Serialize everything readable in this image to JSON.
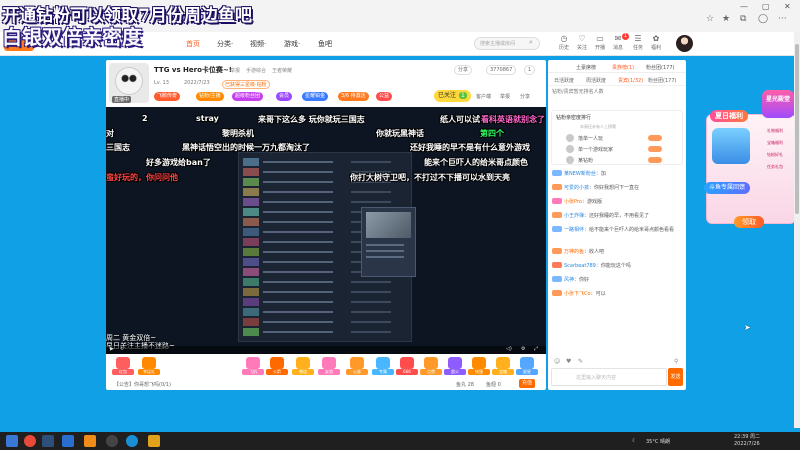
{
  "overlay": {
    "line1": "开通钻粉可以领取7月份周边鱼吧",
    "line2": "白银双倍亲密度"
  },
  "nav": {
    "items": [
      "首页",
      "分类·",
      "视频·",
      "游戏·",
      "鱼吧"
    ],
    "search_placeholder": "搜索主播或房间",
    "tools": [
      {
        "icon": "history-icon",
        "glyph": "◷",
        "label": "历史"
      },
      {
        "icon": "follow-icon",
        "glyph": "♡",
        "label": "关注"
      },
      {
        "icon": "anchor-icon",
        "glyph": "▭",
        "label": "开播"
      },
      {
        "icon": "mail-icon",
        "glyph": "✉",
        "label": "消息"
      },
      {
        "icon": "message-icon",
        "glyph": "☰",
        "label": "任务"
      },
      {
        "icon": "gift-icon",
        "glyph": "✿",
        "label": "福利"
      }
    ],
    "badge_count": "1"
  },
  "player": {
    "title": "TTG vs Hero卡位赛~!",
    "tags": [
      "举报",
      "手游综合",
      "王者荣耀"
    ],
    "meta": [
      "Lv. 13",
      "2022/7/23",
      "已获得三星级·钻粉"
    ],
    "live_badge": "直播中",
    "pills": [
      {
        "text": "飞鹅传奇",
        "color": "#ff5b2e"
      },
      {
        "text": "钻粉/主播",
        "color": "#ff8a00"
      },
      {
        "text": "超级粉丝团",
        "color": "#c53ef0"
      },
      {
        "text": "会员",
        "color": "#9a48ff"
      },
      {
        "text": "星耀铂金",
        "color": "#3a7bff"
      },
      {
        "text": "3/6 待激活",
        "color": "#ff7a1c"
      },
      {
        "text": "公益",
        "color": "#ff4d4d"
      }
    ],
    "hdr_buttons": [
      "分享",
      "3770867",
      "1"
    ],
    "follow_label": "已关注",
    "follow_count": "1",
    "hdr_right": [
      "客户端",
      "举报",
      "分享"
    ]
  },
  "danmaku": [
    {
      "text": "2",
      "color": "#ffffff"
    },
    {
      "text": "stray",
      "color": "#ffffff"
    },
    {
      "text": "来哥下这么多 玩你就玩三国志",
      "color": "#ffffff"
    },
    {
      "text": "纸人可以试",
      "color": "#ffffff"
    },
    {
      "text": "看科英语就别念了",
      "color": "#ff66cc"
    },
    {
      "text": "对",
      "color": "#ffffff"
    },
    {
      "text": "黎明杀机",
      "color": "#ffffff"
    },
    {
      "text": "你就玩黑神话",
      "color": "#ffffff"
    },
    {
      "text": "第四个",
      "color": "#33ff66"
    },
    {
      "text": "三国志",
      "color": "#ffffff"
    },
    {
      "text": "黑神话悟空出的时候一万九都淘汰了",
      "color": "#ffffff"
    },
    {
      "text": "还好我睡的早不是有什么意外游戏",
      "color": "#ffffff"
    },
    {
      "text": "好多游戏给ban了",
      "color": "#ffffff"
    },
    {
      "text": "能来个巨吓人的给米哥点颜色",
      "color": "#ffffff"
    },
    {
      "text": "蛮好玩的，你问问他",
      "color": "#ff4444"
    },
    {
      "text": "你打大树守卫吧，不打过不下播可以水到天亮",
      "color": "#ffffff"
    }
  ],
  "video_notes": [
    "周二 黄金双倍~",
    "早日关注主播不迷路~"
  ],
  "gifts": [
    {
      "label": "红包",
      "color": "#ff5e5e"
    },
    {
      "label": "幸运礼",
      "color": "#ff8a00"
    },
    {
      "label": "飞机",
      "color": "#ff7ab8"
    },
    {
      "label": "火箭",
      "color": "#ff6a00"
    },
    {
      "label": "赠送",
      "color": "#ffb01c"
    },
    {
      "label": "友谊",
      "color": "#ff7ab8"
    },
    {
      "label": "心意",
      "color": "#ff9a2a"
    },
    {
      "label": "专属",
      "color": "#48b7ff"
    },
    {
      "label": "666",
      "color": "#ff4d4d"
    },
    {
      "label": "点赞",
      "color": "#ff9a2a"
    },
    {
      "label": "超火",
      "color": "#8e5cff"
    },
    {
      "label": "帐篷",
      "color": "#ff8a00"
    },
    {
      "label": "宝箱",
      "color": "#ffb01c"
    },
    {
      "label": "星星",
      "color": "#55a6ff"
    },
    {
      "label": "礼盒",
      "color": "#ff6a9a"
    }
  ],
  "bottom_bar": {
    "announcement": "【公告】你哥想飞吗(0/1)",
    "fish_balls": "鱼丸 28",
    "fish_wings": "鱼翅 0",
    "recharge": "充值"
  },
  "chat": {
    "tabs": [
      "土豪席榜",
      "贵族榜(1)",
      "粉丝团(177)"
    ],
    "ranks": [
      "日活跃度",
      "周活跃度",
      "贵宾(1/32)",
      "粉丝团(177)"
    ],
    "notice": "钻粉/贵宾暂无排名人数",
    "rank_box_head": "钻粉亲密度排行",
    "rank_box_sub": "本周还未有人上榜哦",
    "rank_rows": [
      "落单一人玩",
      "单一个游戏玩家",
      "某钻粉"
    ],
    "messages": [
      {
        "user": "某NEW新粉丝",
        "text": "：加"
      },
      {
        "user": "可爱的小孩",
        "text": "：你好我想问下一直在"
      },
      {
        "user": "小张Pro",
        "text": "：游戏版"
      },
      {
        "user": "小王炸弹",
        "text": "：还好我睡的早，不用看见了"
      },
      {
        "user": "一路相伴",
        "text": "：给不能来个巨吓人的给米哥点颜色看看"
      },
      {
        "user": "万神的鱼",
        "text": "：收人吧"
      },
      {
        "user": "Scarbeat789",
        "text": "：你能玩这个吗"
      },
      {
        "user": "风神",
        "text": "：你好"
      },
      {
        "user": "小张下飞Co",
        "text": "：可以"
      }
    ],
    "input_placeholder": "这里输入聊天内容",
    "send_label": "发送"
  },
  "promo": {
    "title": "夏日福利",
    "badge": "星光殿堂",
    "banner": "斗鱼专属回馈",
    "claim": "领取",
    "side_items": [
      "礼物福利",
      "宝箱福利",
      "钻粉好礼",
      "任务礼包"
    ]
  },
  "taskbar": {
    "weather": "35°C 晴朗",
    "time": "22:39 周二",
    "date": "2022/7/26"
  }
}
